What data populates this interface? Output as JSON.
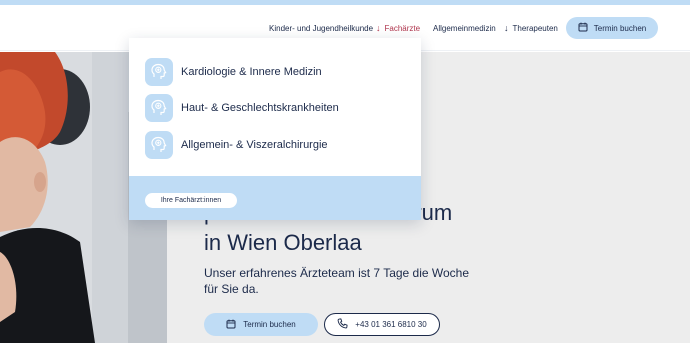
{
  "header": {
    "nav": [
      {
        "label": "Kinder- und Jugendheilkunde",
        "arrow": "",
        "active": false
      },
      {
        "label": "Fachärzte",
        "arrow": "↓",
        "active": true
      },
      {
        "label": "Allgemeinmedizin",
        "arrow": "",
        "active": false
      },
      {
        "label": "Therapeuten",
        "arrow": "↓",
        "active": false
      }
    ],
    "book_button": "Termin buchen"
  },
  "dropdown": {
    "items": [
      {
        "label": "Kardiologie & Innere Medizin",
        "icon": "head-medical-icon"
      },
      {
        "label": "Haut- & Geschlechtskrankheiten",
        "icon": "head-medical-icon"
      },
      {
        "label": "Allgemein- & Viszeralchirurgie",
        "icon": "head-medical-icon"
      }
    ],
    "footer_button": "Ihre Fachärzt:innen"
  },
  "hero": {
    "title_line1": "privaten Medizin Zentrum",
    "title_line2": "in Wien Oberlaa",
    "subtitle_line1": "Unser erfahrenes Ärzteteam ist 7 Tage die Woche",
    "subtitle_line2": "für Sie da.",
    "cta_book": "Termin buchen",
    "cta_phone": "+43 01 361 6810 30"
  },
  "colors": {
    "accent_light_blue": "#bfdcf5",
    "navy_text": "#1c2a4a",
    "active_red": "#b0364e",
    "hero_background": "#ededed"
  }
}
